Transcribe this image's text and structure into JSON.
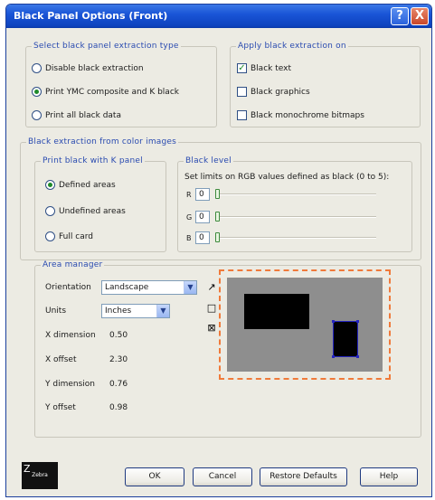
{
  "window": {
    "title": "Black Panel Options (Front)",
    "help_glyph": "?",
    "close_glyph": "X"
  },
  "extraction_type": {
    "legend": "Select black panel extraction type",
    "options": [
      {
        "label": "Disable black extraction",
        "selected": false
      },
      {
        "label": "Print YMC composite and K black",
        "selected": true
      },
      {
        "label": "Print all black data",
        "selected": false
      }
    ]
  },
  "apply_on": {
    "legend": "Apply black extraction on",
    "options": [
      {
        "label": "Black text",
        "checked": true,
        "mark": "✓"
      },
      {
        "label": "Black graphics",
        "checked": false,
        "mark": ""
      },
      {
        "label": "Black monochrome bitmaps",
        "checked": false,
        "mark": ""
      }
    ]
  },
  "color_images": {
    "legend": "Black extraction from color images",
    "k_panel": {
      "legend": "Print black with K panel",
      "options": [
        {
          "label": "Defined areas",
          "selected": true
        },
        {
          "label": "Undefined areas",
          "selected": false
        },
        {
          "label": "Full card",
          "selected": false
        }
      ]
    },
    "black_level": {
      "legend": "Black level",
      "caption": "Set limits on RGB values defined as black (0 to 5):",
      "channels": [
        {
          "label": "R",
          "value": "0",
          "level": 0
        },
        {
          "label": "G",
          "value": "0",
          "level": 0
        },
        {
          "label": "B",
          "value": "0",
          "level": 0
        }
      ]
    }
  },
  "area_manager": {
    "legend": "Area manager",
    "orientation": {
      "label": "Orientation",
      "value": "Landscape"
    },
    "units": {
      "label": "Units",
      "value": "Inches"
    },
    "fields": [
      {
        "label": "X dimension",
        "value": "0.50"
      },
      {
        "label": "X offset",
        "value": "2.30"
      },
      {
        "label": "Y dimension",
        "value": "0.76"
      },
      {
        "label": "Y offset",
        "value": "0.98"
      }
    ],
    "tools": {
      "select": "↗",
      "rect": "□",
      "delete": "⊠"
    }
  },
  "buttons": {
    "ok": "OK",
    "cancel": "Cancel",
    "restore": "Restore Defaults",
    "help": "Help"
  },
  "logo": {
    "text": "Zebra",
    "glyph": "Z"
  },
  "colors": {
    "title_bar": "#1a55d7",
    "preview_dash": "#f07a3a",
    "preview_card": "#8e8e8e",
    "selection": "#2424c0"
  }
}
